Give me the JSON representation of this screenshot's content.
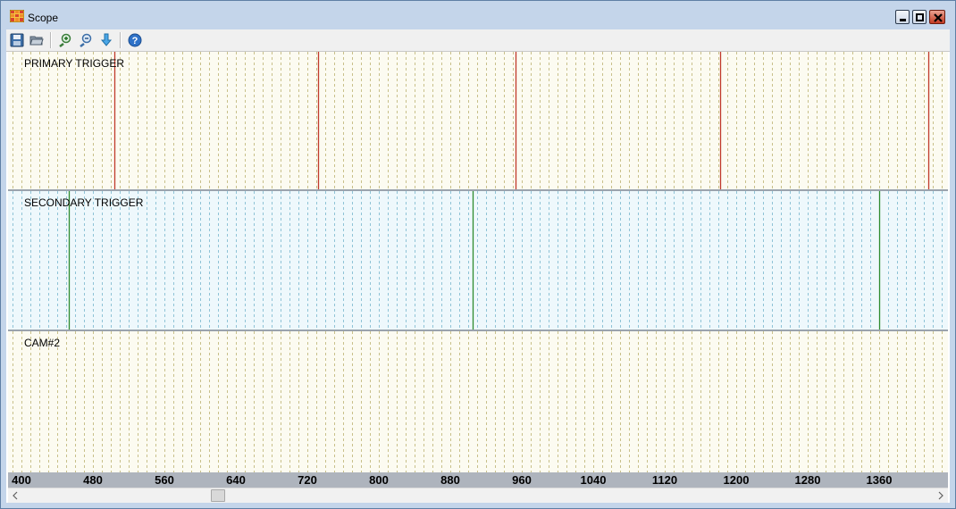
{
  "window": {
    "title": "Scope"
  },
  "toolbar": {
    "buttons": [
      {
        "name": "save-button",
        "icon": "floppy-disk-icon"
      },
      {
        "name": "open-button",
        "icon": "folder-open-icon"
      },
      {
        "name": "zoom-in-button",
        "icon": "zoom-in-icon"
      },
      {
        "name": "zoom-out-button",
        "icon": "zoom-out-icon"
      },
      {
        "name": "download-button",
        "icon": "down-arrow-icon"
      },
      {
        "name": "help-button",
        "icon": "help-icon"
      }
    ]
  },
  "tracks": [
    {
      "label": "PRIMARY TRIGGER",
      "background": "#fcfbf1",
      "grid_color": "#c8c08a",
      "pulse_color": "#c0392b",
      "pulses": [
        504,
        732,
        953,
        1182,
        1415
      ]
    },
    {
      "label": "SECONDARY TRIGGER",
      "background": "#eef8fc",
      "grid_color": "#8fc3d6",
      "pulse_color": "#2e8b2e",
      "pulses": [
        453,
        905,
        1360
      ]
    },
    {
      "label": "CAM#2",
      "background": "#fcfbf1",
      "grid_color": "#c8c08a",
      "pulse_color": "#c0392b",
      "pulses": []
    }
  ],
  "axis": {
    "view_start": 385,
    "view_end": 1437,
    "grid_step": 10,
    "tick_values": [
      "400",
      "480",
      "560",
      "640",
      "720",
      "800",
      "880",
      "960",
      "1040",
      "1120",
      "1200",
      "1280",
      "1360"
    ]
  },
  "scrollbar": {
    "position": 0.21
  }
}
